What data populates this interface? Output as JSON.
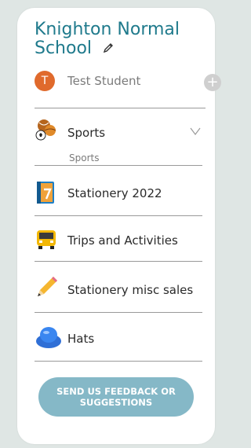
{
  "school": {
    "name": "Knighton Normal School",
    "edit_icon": "pencil-icon"
  },
  "student": {
    "initial": "T",
    "name": "Test Student",
    "add_icon": "plus-icon",
    "avatar_color": "#e06a2c"
  },
  "categories": [
    {
      "label": "Sports",
      "icon": "sports-balls-icon",
      "expanded": true,
      "subitems": [
        "Sports"
      ]
    },
    {
      "label": "Stationery 2022",
      "icon": "notebook-icon"
    },
    {
      "label": "Trips and Activities",
      "icon": "school-bus-icon"
    },
    {
      "label": "Stationery misc sales",
      "icon": "pencil-icon"
    },
    {
      "label": "Hats",
      "icon": "blue-hat-icon"
    }
  ],
  "feedback_button": {
    "label": "SEND US FEEDBACK OR SUGGESTIONS"
  },
  "colors": {
    "accent": "#1f7a8c",
    "button": "#85b8c7"
  }
}
